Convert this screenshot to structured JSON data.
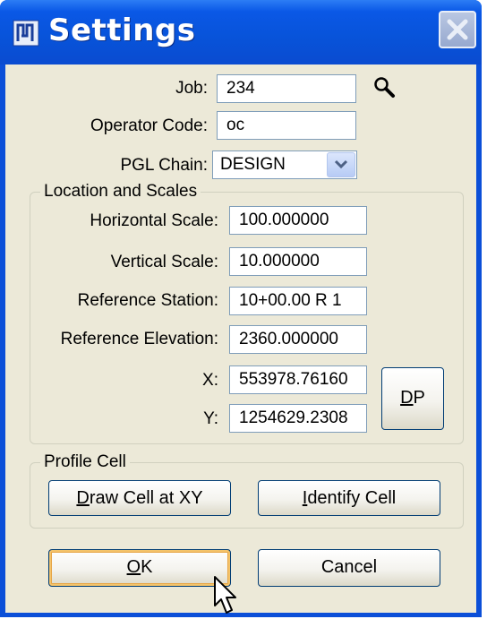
{
  "window": {
    "title": "Settings"
  },
  "fields": {
    "job": {
      "label": "Job:",
      "value": "234"
    },
    "operator_code": {
      "label": "Operator Code:",
      "value": "oc"
    },
    "pgl_chain": {
      "label": "PGL Chain:",
      "value": "DESIGN"
    }
  },
  "location_scales": {
    "legend": "Location and Scales",
    "horizontal_scale": {
      "label": "Horizontal Scale:",
      "value": "100.000000"
    },
    "vertical_scale": {
      "label": "Vertical Scale:",
      "value": "10.000000"
    },
    "reference_station": {
      "label": "Reference Station:",
      "value": "10+00.00 R 1"
    },
    "reference_elevation": {
      "label": "Reference Elevation:",
      "value": "2360.000000"
    },
    "x": {
      "label": "X:",
      "value": "553978.76160"
    },
    "y": {
      "label": "Y:",
      "value": "1254629.2308"
    },
    "dp_button": {
      "mnemonic": "D",
      "rest": "P"
    }
  },
  "profile_cell": {
    "legend": "Profile Cell",
    "draw_button": {
      "mnemonic": "D",
      "rest": "raw Cell at XY"
    },
    "identify_button": {
      "mnemonic": "I",
      "rest": "dentify Cell"
    }
  },
  "buttons": {
    "ok": {
      "mnemonic": "O",
      "rest": "K"
    },
    "cancel": "Cancel"
  },
  "icons": {
    "app": "app-icon",
    "close": "close-icon",
    "search": "magnifier-icon",
    "dropdown": "chevron-down-icon",
    "cursor": "mouse-pointer-icon"
  },
  "colors": {
    "titlebar": "#0a58e6",
    "dialog_bg": "#ece9d8",
    "default_button_highlight": "#f4c46c"
  }
}
